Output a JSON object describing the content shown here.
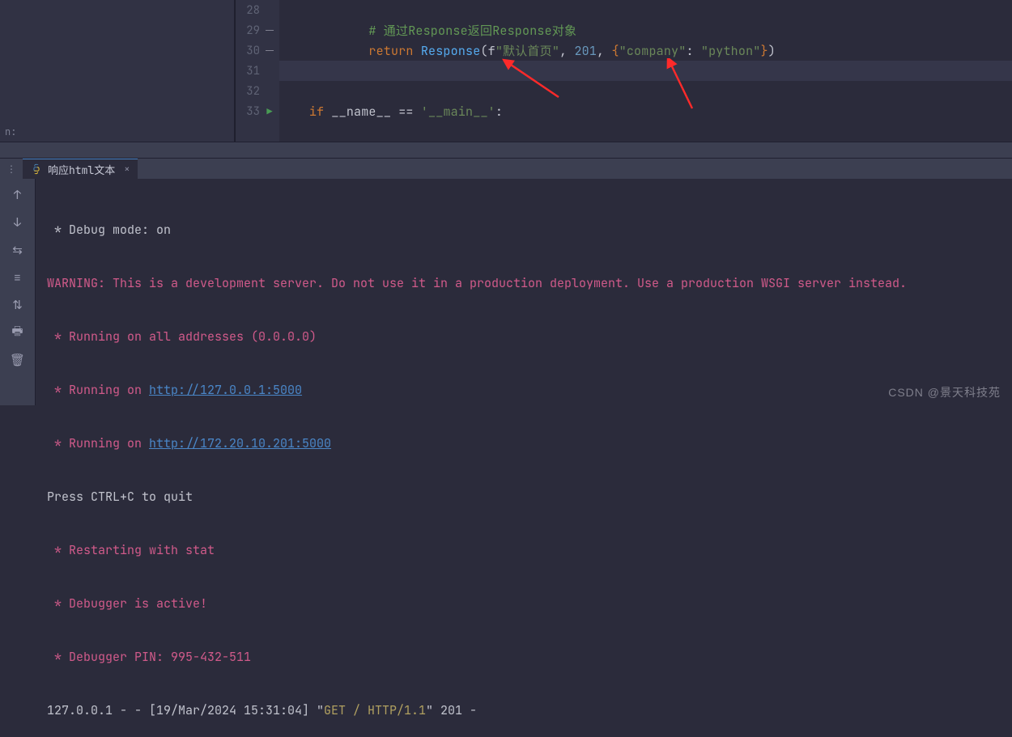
{
  "editor": {
    "left_label": "n:",
    "lines": {
      "l28": {
        "num": "28"
      },
      "l29": {
        "num": "29",
        "comment_hash": "#",
        "comment_rest": " 通过Response返回Response对象"
      },
      "l30": {
        "num": "30",
        "kw": "return ",
        "fn": "Response",
        "open": "(",
        "f": "f",
        "str1": "\"默认首页\"",
        "comma1": ", ",
        "status": "201",
        "comma2": ", ",
        "brace_l": "{",
        "key": "\"company\"",
        "colon": ": ",
        "val": "\"python\"",
        "brace_r": "}",
        "close": ")"
      },
      "l31": {
        "num": "31"
      },
      "l32": {
        "num": "32"
      },
      "l33": {
        "num": "33",
        "if": "if ",
        "name": "__name__",
        "eq": " == ",
        "main": "'__main__'",
        "colon": ":"
      }
    }
  },
  "tab": {
    "name": "响应html文本",
    "close": "×"
  },
  "toolbar": {
    "up": "↑",
    "down": "↓",
    "wrap": "⇆",
    "scroll": "≡",
    "diff": "⇅",
    "print": "🖶",
    "trash": "🗑"
  },
  "terminal": {
    "t0": " * Debug mode: on",
    "t1": "WARNING: This is a development server. Do not use it in a production deployment. Use a production WSGI server instead.",
    "t2_a": " * Running on all addresses (0.0.0.0)",
    "t3_a": " * Running on ",
    "t3_b": "http://127.0.0.1:5000",
    "t4_a": " * Running on ",
    "t4_b": "http://172.20.10.201:5000",
    "t5": "Press CTRL+C to quit",
    "t6": " * Restarting with stat",
    "t7": " * Debugger is active!",
    "t8": " * Debugger PIN: 995-432-511",
    "t9_a": "127.0.0.1 - - [19/Mar/2024 15:31:04] \"",
    "t9_b": "GET / HTTP/1.1",
    "t9_c": "\" 201 -"
  },
  "watermark": "CSDN @景天科技苑"
}
